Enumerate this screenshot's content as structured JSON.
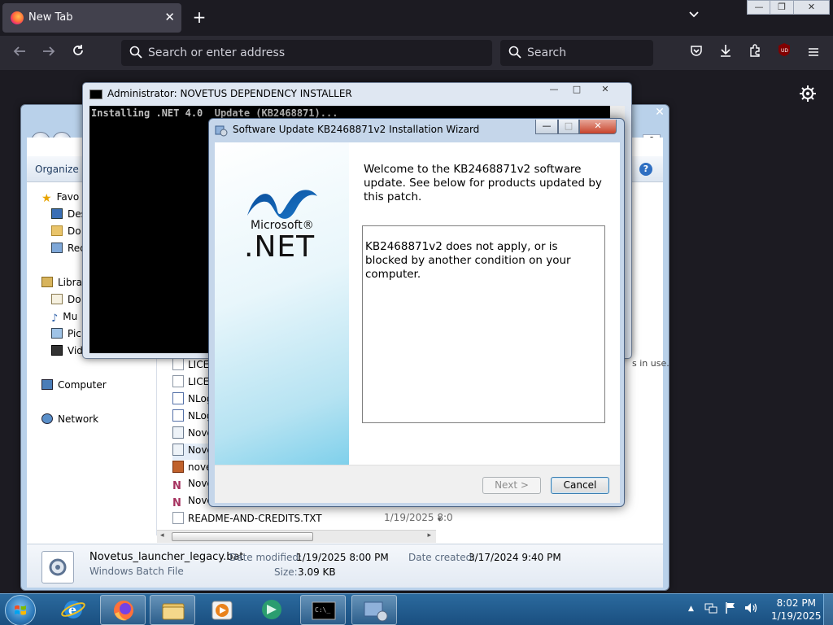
{
  "firefox": {
    "tab": {
      "title": "New Tab"
    },
    "urlbar": {
      "placeholder": "Search or enter address"
    },
    "searchbar": {
      "placeholder": "Search"
    }
  },
  "explorer": {
    "toolbar": {
      "organize": "Organize"
    },
    "nav": {
      "favorites": "Favo",
      "desktop": "Des",
      "downloads": "Do",
      "recent": "Rec",
      "libraries": "Libra",
      "documents": "Do",
      "music": "Mu",
      "pictures": "Pic",
      "videos": "Vid",
      "computer": "Computer",
      "network": "Network"
    },
    "files": [
      {
        "name": "LICEI"
      },
      {
        "name": "LICEI"
      },
      {
        "name": "NLog"
      },
      {
        "name": "NLog"
      },
      {
        "name": "Nove"
      },
      {
        "name": "Nove"
      },
      {
        "name": "nove"
      },
      {
        "name": "Nove"
      },
      {
        "name": "Nove"
      },
      {
        "name": "README-AND-CREDITS.TXT",
        "date": "1/19/2025 8:0"
      }
    ],
    "in_use_text": "s in use.",
    "details": {
      "filename": "Novetus_launcher_legacy.bat",
      "filetype": "Windows Batch File",
      "modified_label": "Date modified:",
      "modified_value": "1/19/2025 8:00 PM",
      "size_label": "Size:",
      "size_value": "3.09 KB",
      "created_label": "Date created:",
      "created_value": "3/17/2024 9:40 PM"
    }
  },
  "console": {
    "title": "Administrator:  NOVETUS DEPENDENCY INSTALLER",
    "output": "Installing .NET 4.0  Update (KB2468871)..."
  },
  "dialog": {
    "title": "Software Update KB2468871v2 Installation Wizard",
    "logo_microsoft": "Microsoft®",
    "logo_net": ".NET",
    "welcome": "Welcome to the KB2468871v2 software update. See below for products updated by this patch.",
    "message": "KB2468871v2 does not apply, or is blocked by another condition on your computer.",
    "next_button": "Next >",
    "cancel_button": "Cancel"
  },
  "taskbar": {
    "time": "8:02 PM",
    "date": "1/19/2025"
  },
  "colors": {
    "firefox_bg": "#1c1b22",
    "firefox_toolbar": "#2b2a33",
    "taskbar": "#1a4f80",
    "console_bg": "#000000",
    "dialog_frame": "#c5d6ea"
  },
  "icons": [
    "firefox-icon",
    "close-icon",
    "plus-icon",
    "chevron-down-icon",
    "back-arrow-icon",
    "forward-arrow-icon",
    "reload-icon",
    "search-icon",
    "pocket-icon",
    "download-icon",
    "extensions-icon",
    "ublock-icon",
    "menu-icon",
    "gear-icon",
    "dotnet-logo-icon",
    "windows-start-icon",
    "ie-icon",
    "folder-icon",
    "media-player-icon",
    "cmd-icon",
    "network-icon",
    "volume-icon",
    "flag-icon"
  ]
}
